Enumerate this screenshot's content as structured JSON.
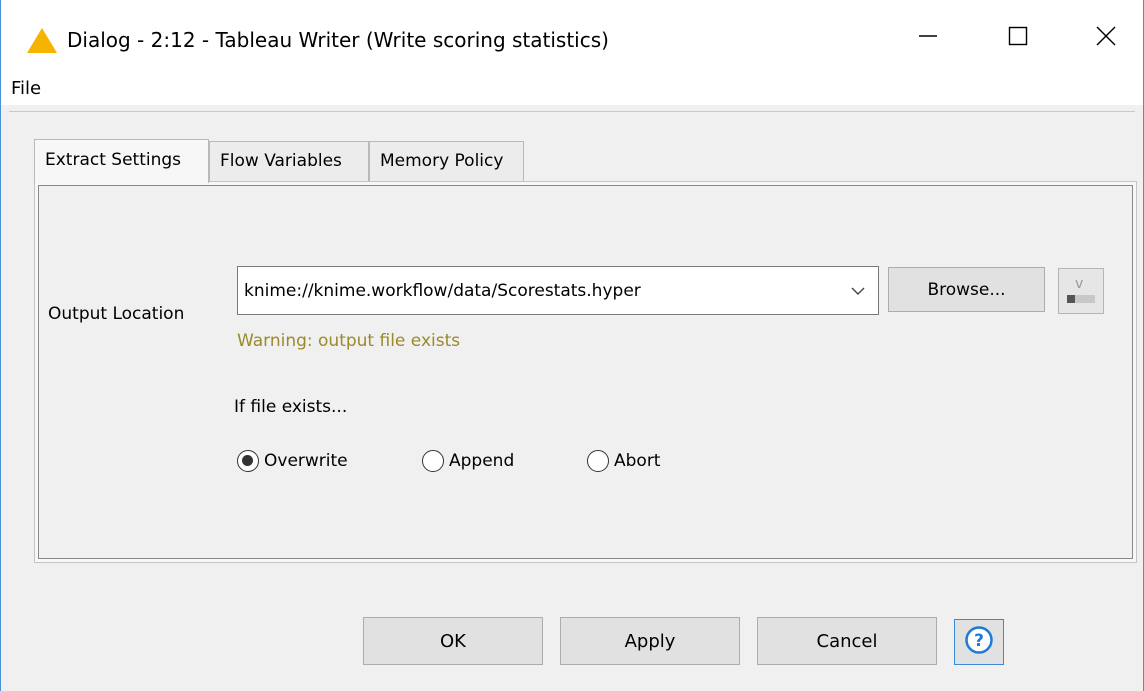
{
  "window": {
    "title": "Dialog - 2:12 - Tableau Writer  (Write scoring statistics)"
  },
  "menu": {
    "file": "File"
  },
  "tabs": [
    {
      "label": "Extract Settings",
      "active": true
    },
    {
      "label": "Flow Variables",
      "active": false
    },
    {
      "label": "Memory Policy",
      "active": false
    }
  ],
  "output": {
    "label": "Output Location",
    "value": "knime://knime.workflow/data/Scorestats.hyper",
    "browse_label": "Browse...",
    "warning": "Warning: output file exists"
  },
  "if_exists": {
    "label": "If file exists...",
    "options": [
      {
        "label": "Overwrite",
        "selected": true
      },
      {
        "label": "Append",
        "selected": false
      },
      {
        "label": "Abort",
        "selected": false
      }
    ]
  },
  "buttons": {
    "ok": "OK",
    "apply": "Apply",
    "cancel": "Cancel"
  },
  "colors": {
    "warning_icon": "#f5b400",
    "warning_text": "#9a8a2a",
    "help_icon": "#1e7ad4",
    "window_border": "#4a90d9"
  },
  "icons": {
    "title": "warning-triangle-icon",
    "minimize": "minimize-icon",
    "maximize": "maximize-icon",
    "close": "close-icon",
    "dropdown": "chevron-down-icon",
    "flow_variable": "flow-variable-icon",
    "help": "help-icon"
  }
}
